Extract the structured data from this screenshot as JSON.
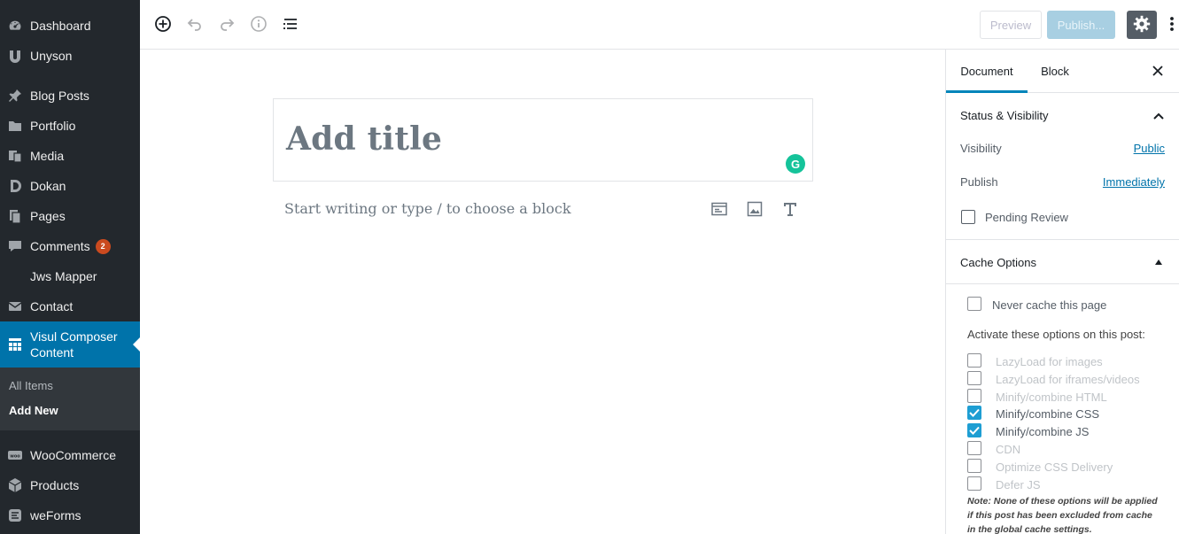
{
  "admin_menu": {
    "items": [
      {
        "label": "Dashboard",
        "icon": "dashboard-icon"
      },
      {
        "label": "Unyson",
        "icon": "unyson-icon"
      },
      {
        "label": "Blog Posts",
        "icon": "pin-icon"
      },
      {
        "label": "Portfolio",
        "icon": "folder-icon"
      },
      {
        "label": "Media",
        "icon": "media-icon"
      },
      {
        "label": "Dokan",
        "icon": "dokan-icon"
      },
      {
        "label": "Pages",
        "icon": "pages-icon"
      },
      {
        "label": "Comments",
        "icon": "comment-icon",
        "badge": "2"
      },
      {
        "label": "Jws Mapper",
        "icon": ""
      },
      {
        "label": "Contact",
        "icon": "mail-icon"
      },
      {
        "label": "Visul Composer Content",
        "icon": "grid-icon"
      },
      {
        "label": "WooCommerce",
        "icon": "woo-icon"
      },
      {
        "label": "Products",
        "icon": "box-icon"
      },
      {
        "label": "weForms",
        "icon": "weforms-icon"
      }
    ],
    "submenu": [
      {
        "label": "All Items"
      },
      {
        "label": "Add New"
      }
    ]
  },
  "toolbar": {
    "icons": [
      "add-block-icon",
      "undo-icon",
      "redo-icon",
      "info-icon",
      "list-view-icon"
    ],
    "preview_label": "Preview",
    "publish_label": "Publish...",
    "settings_icon": "gear-icon",
    "more_icon": "more-vertical-icon"
  },
  "editor": {
    "title_placeholder": "Add title",
    "block_placeholder": "Start writing or type / to choose a block"
  },
  "sidebar": {
    "tabs": [
      "Document",
      "Block"
    ],
    "status_panel": {
      "title": "Status & Visibility",
      "visibility_label": "Visibility",
      "visibility_value": "Public",
      "publish_label": "Publish",
      "publish_value": "Immediately",
      "pending_label": "Pending Review"
    },
    "cache_panel": {
      "title": "Cache Options",
      "never_cache_label": "Never cache this page",
      "activate_label": "Activate these options on this post:",
      "options": [
        {
          "label": "LazyLoad for images",
          "checked": false
        },
        {
          "label": "LazyLoad for iframes/videos",
          "checked": false
        },
        {
          "label": "Minify/combine HTML",
          "checked": false
        },
        {
          "label": "Minify/combine CSS",
          "checked": true
        },
        {
          "label": "Minify/combine JS",
          "checked": true
        },
        {
          "label": "CDN",
          "checked": false
        },
        {
          "label": "Optimize CSS Delivery",
          "checked": false
        },
        {
          "label": "Defer JS",
          "checked": false
        }
      ],
      "note": "Note: None of these options will be applied if this post has been excluded from cache in the global cache settings."
    }
  },
  "colors": {
    "admin_bg": "#23282d",
    "admin_active": "#0073aa",
    "publish_btn": "#a8cfe2",
    "checkbox_checked": "#1e9ed3",
    "link": "#0073aa"
  }
}
